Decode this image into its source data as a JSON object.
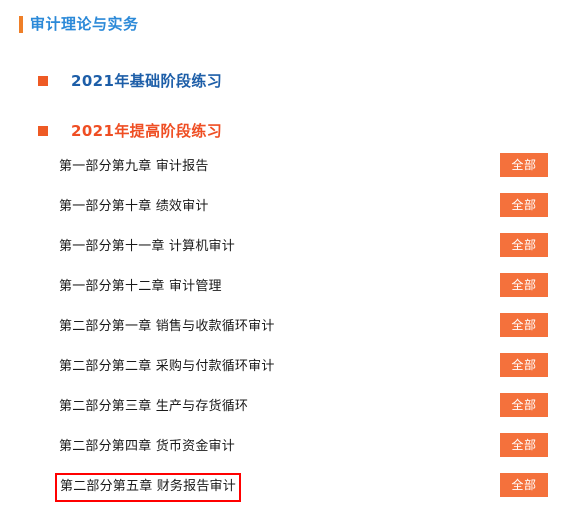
{
  "page": {
    "title": "审计理论与实务"
  },
  "sections": [
    {
      "label": "2021年基础阶段练习",
      "color": "#1d5ea8"
    },
    {
      "label": "2021年提高阶段练习",
      "color": "#ef4e23"
    }
  ],
  "button_label": "全部",
  "chapters": [
    {
      "name": "第一部分第九章  审计报告",
      "button": "全部",
      "highlighted": false
    },
    {
      "name": "第一部分第十章  绩效审计",
      "button": "全部",
      "highlighted": false
    },
    {
      "name": "第一部分第十一章  计算机审计",
      "button": "全部",
      "highlighted": false
    },
    {
      "name": "第一部分第十二章  审计管理",
      "button": "全部",
      "highlighted": false
    },
    {
      "name": "第二部分第一章  销售与收款循环审计",
      "button": "全部",
      "highlighted": false
    },
    {
      "name": "第二部分第二章  采购与付款循环审计",
      "button": "全部",
      "highlighted": false
    },
    {
      "name": "第二部分第三章  生产与存货循环",
      "button": "全部",
      "highlighted": false
    },
    {
      "name": "第二部分第四章  货币资金审计",
      "button": "全部",
      "highlighted": false
    },
    {
      "name": "第二部分第五章  财务报告审计",
      "button": "全部",
      "highlighted": true
    }
  ],
  "colors": {
    "title_blue": "#2b89d8",
    "title_bar_orange": "#ef7f28",
    "bullet_orange": "#ee5a24",
    "button_orange": "#f4713c",
    "highlight_red": "#ff0000"
  }
}
